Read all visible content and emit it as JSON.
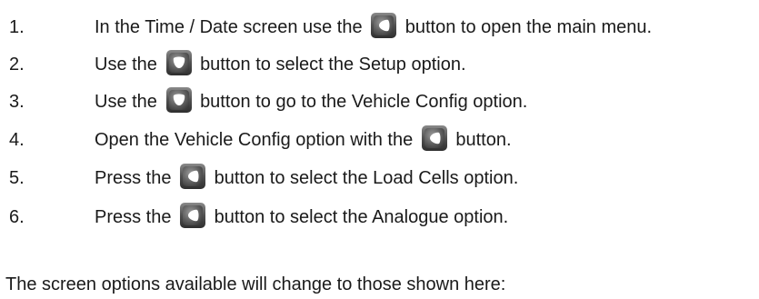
{
  "steps": [
    {
      "num": "1.",
      "before": "In the Time / Date screen use the",
      "icon": "right-arrow-button-icon",
      "after": "button to open the main menu."
    },
    {
      "num": "2.",
      "before": "Use the",
      "icon": "down-arrow-button-icon",
      "after": "button to select the Setup option."
    },
    {
      "num": "3.",
      "before": "Use the",
      "icon": "down-arrow-button-icon",
      "after": "button to go to the Vehicle Config option."
    },
    {
      "num": "4.",
      "before": "Open the Vehicle Config option with the",
      "icon": "right-arrow-button-icon",
      "after": "button."
    },
    {
      "num": "5.",
      "before": "Press the",
      "icon": "right-arrow-button-icon",
      "after": "button to select the Load Cells option."
    },
    {
      "num": "6.",
      "before": "Press the",
      "icon": "right-arrow-button-icon",
      "after": "button to select the Analogue option."
    }
  ],
  "footer": "The screen options available will change to those shown here:",
  "colors": {
    "text": "#1a1a1a",
    "button_bezel": "#4a4a4a",
    "button_face": "#6a6a6a",
    "button_arrow": "#ffffff"
  }
}
